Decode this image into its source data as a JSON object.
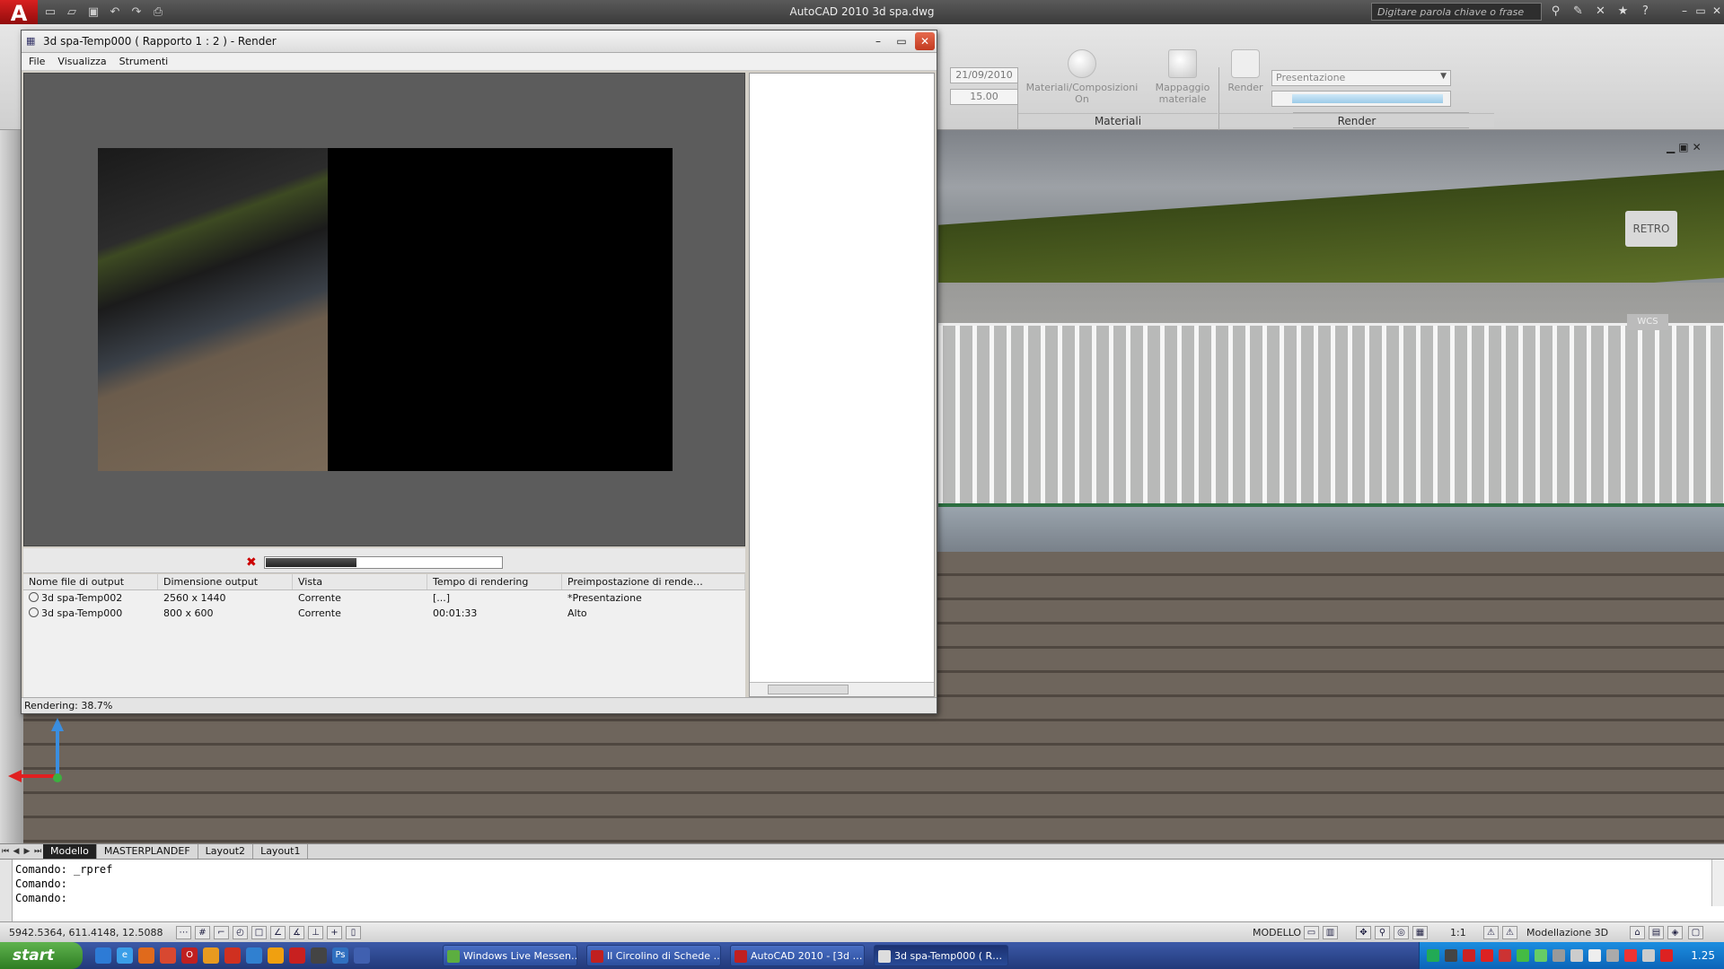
{
  "app": {
    "window_title": "AutoCAD 2010    3d spa.dwg",
    "search_placeholder": "Digitare parola chiave o frase"
  },
  "ribbon": {
    "date_value": "21/09/2010",
    "time_value": "15.00",
    "materials_on_label": "Materiali/Composizioni On",
    "material_mapping_label": "Mappaggio materiale",
    "render_label": "Render",
    "preset_value": "Presentazione",
    "panels": {
      "materials": "Materiali",
      "render": "Render"
    },
    "more_button": "..."
  },
  "render_window": {
    "title": "3d spa-Temp000  ( Rapporto 1 : 2 ) - Render",
    "menu": [
      "File",
      "Visualizza",
      "Strumenti"
    ],
    "progress_fraction": 0.387,
    "status": "Rendering: 38.7%",
    "history_columns": [
      "Nome file di output",
      "Dimensione output",
      "Vista",
      "Tempo di rendering",
      "Preimpostazione di rende…"
    ],
    "history_rows": [
      {
        "file": "3d spa-Temp002",
        "size": "2560 x 1440",
        "view": "Corrente",
        "time": "[...]",
        "preset": "*Presentazione"
      },
      {
        "file": "3d spa-Temp000",
        "size": "800 x 600",
        "view": "Corrente",
        "time": "00:01:33",
        "preset": "Alto"
      }
    ]
  },
  "viewport": {
    "retro_label": "RETRO",
    "wcs_label": "WCS"
  },
  "layout_tabs": [
    "Modello",
    "MASTERPLANDEF",
    "Layout2",
    "Layout1"
  ],
  "command_lines": [
    "Comando:  _rpref",
    "Comando:",
    "Comando:"
  ],
  "statusbar": {
    "coords": "5942.5364, 611.4148, 12.5088",
    "mode": "MODELLO",
    "scale": "1:1",
    "workspace": "Modellazione 3D"
  },
  "taskbar": {
    "start": "start",
    "tasks": [
      {
        "label": "Windows Live Messen…"
      },
      {
        "label": "Il Circolino di Schede …"
      },
      {
        "label": "AutoCAD 2010 - [3d …"
      },
      {
        "label": "3d spa-Temp000  ( R…"
      }
    ],
    "clock": "1.25"
  },
  "colors": {
    "accent_red": "#c02020",
    "taskbar_blue": "#2c4f9e",
    "start_green": "#3e9a30"
  },
  "icons": {
    "app_logo": "autocad-logo-icon",
    "close": "close-icon",
    "cancel_render": "cancel-render-icon"
  }
}
